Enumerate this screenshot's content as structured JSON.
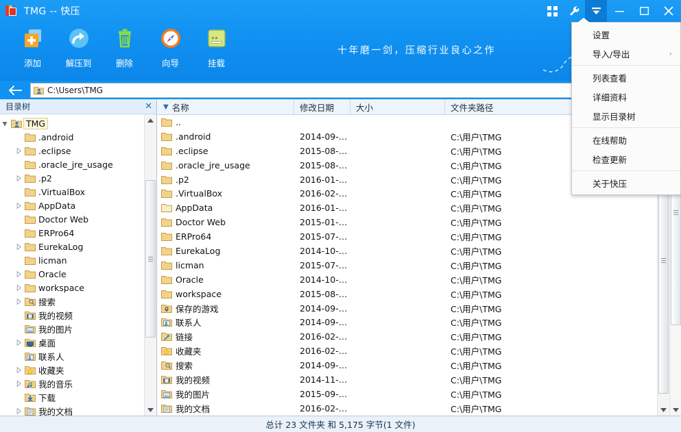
{
  "window": {
    "title": "TMG -- 快压",
    "app_icon": "archive-icon"
  },
  "titlebar_buttons": [
    {
      "name": "apps-grid-icon",
      "label": "应用"
    },
    {
      "name": "wrench-icon",
      "label": "工具"
    },
    {
      "name": "menu-caret-icon",
      "label": "菜单"
    },
    {
      "name": "minimize-icon",
      "label": "最小化"
    },
    {
      "name": "maximize-icon",
      "label": "最大化"
    },
    {
      "name": "close-icon",
      "label": "关闭"
    }
  ],
  "toolbar": {
    "items": [
      {
        "label": "添加",
        "icon": "add-files-icon"
      },
      {
        "label": "解压到",
        "icon": "extract-arrow-icon"
      },
      {
        "label": "删除",
        "icon": "trash-icon"
      },
      {
        "label": "向导",
        "icon": "compass-wizard-icon"
      },
      {
        "label": "挂载",
        "icon": "mount-drive-icon"
      }
    ]
  },
  "banner": {
    "slogan": "十年磨一剑，压缩行业良心之作"
  },
  "address_bar": {
    "back_icon": "back-arrow-icon",
    "folder_icon": "user-folder-icon",
    "path": "C:\\Users\\TMG"
  },
  "tree_panel": {
    "title": "目录树",
    "close_icon": "close-icon",
    "nodes": [
      {
        "label": "TMG",
        "depth": 0,
        "expander": "expanded",
        "icon": "user-folder-icon",
        "selected": true
      },
      {
        "label": ".android",
        "depth": 1,
        "expander": "none",
        "icon": "folder-icon",
        "selected": false
      },
      {
        "label": ".eclipse",
        "depth": 1,
        "expander": "collapsed",
        "icon": "folder-icon",
        "selected": false
      },
      {
        "label": ".oracle_jre_usage",
        "depth": 1,
        "expander": "none",
        "icon": "folder-icon",
        "selected": false
      },
      {
        "label": ".p2",
        "depth": 1,
        "expander": "collapsed",
        "icon": "folder-icon",
        "selected": false
      },
      {
        "label": ".VirtualBox",
        "depth": 1,
        "expander": "none",
        "icon": "folder-icon",
        "selected": false
      },
      {
        "label": "AppData",
        "depth": 1,
        "expander": "collapsed",
        "icon": "folder-icon",
        "selected": false
      },
      {
        "label": "Doctor Web",
        "depth": 1,
        "expander": "none",
        "icon": "folder-icon",
        "selected": false
      },
      {
        "label": "ERPro64",
        "depth": 1,
        "expander": "none",
        "icon": "folder-icon",
        "selected": false
      },
      {
        "label": "EurekaLog",
        "depth": 1,
        "expander": "collapsed",
        "icon": "folder-icon",
        "selected": false
      },
      {
        "label": "licman",
        "depth": 1,
        "expander": "none",
        "icon": "folder-icon",
        "selected": false
      },
      {
        "label": "Oracle",
        "depth": 1,
        "expander": "collapsed",
        "icon": "folder-icon",
        "selected": false
      },
      {
        "label": "workspace",
        "depth": 1,
        "expander": "collapsed",
        "icon": "folder-icon",
        "selected": false
      },
      {
        "label": "搜索",
        "depth": 1,
        "expander": "collapsed",
        "icon": "search-folder-icon",
        "selected": false
      },
      {
        "label": "我的视频",
        "depth": 1,
        "expander": "none",
        "icon": "videos-folder-icon",
        "selected": false
      },
      {
        "label": "我的图片",
        "depth": 1,
        "expander": "none",
        "icon": "pictures-folder-icon",
        "selected": false
      },
      {
        "label": "桌面",
        "depth": 1,
        "expander": "collapsed",
        "icon": "desktop-folder-icon",
        "selected": false
      },
      {
        "label": "联系人",
        "depth": 1,
        "expander": "none",
        "icon": "contacts-folder-icon",
        "selected": false
      },
      {
        "label": "收藏夹",
        "depth": 1,
        "expander": "collapsed",
        "icon": "favorites-folder-icon",
        "selected": false
      },
      {
        "label": "我的音乐",
        "depth": 1,
        "expander": "collapsed",
        "icon": "music-folder-icon",
        "selected": false
      },
      {
        "label": "下载",
        "depth": 1,
        "expander": "none",
        "icon": "downloads-folder-icon",
        "selected": false
      },
      {
        "label": "我的文档",
        "depth": 1,
        "expander": "collapsed",
        "icon": "documents-folder-icon",
        "selected": false
      }
    ]
  },
  "file_list": {
    "columns": [
      {
        "label": "名称",
        "sorted": true
      },
      {
        "label": "修改日期",
        "sorted": false
      },
      {
        "label": "大小",
        "sorted": false
      },
      {
        "label": "文件夹路径",
        "sorted": false
      }
    ],
    "sort_arrow": "▼",
    "rows": [
      {
        "name": "..",
        "date": "",
        "size": "",
        "path": "",
        "icon": "parent-folder-icon"
      },
      {
        "name": ".android",
        "date": "2014-09-…",
        "size": "",
        "path": "C:\\用户\\TMG",
        "icon": "folder-icon"
      },
      {
        "name": ".eclipse",
        "date": "2015-08-…",
        "size": "",
        "path": "C:\\用户\\TMG",
        "icon": "folder-icon"
      },
      {
        "name": ".oracle_jre_usage",
        "date": "2015-08-…",
        "size": "",
        "path": "C:\\用户\\TMG",
        "icon": "folder-icon"
      },
      {
        "name": ".p2",
        "date": "2016-01-…",
        "size": "",
        "path": "C:\\用户\\TMG",
        "icon": "folder-icon"
      },
      {
        "name": ".VirtualBox",
        "date": "2016-02-…",
        "size": "",
        "path": "C:\\用户\\TMG",
        "icon": "folder-icon"
      },
      {
        "name": "AppData",
        "date": "2016-01-…",
        "size": "",
        "path": "C:\\用户\\TMG",
        "icon": "folder-hidden-icon"
      },
      {
        "name": "Doctor Web",
        "date": "2015-01-…",
        "size": "",
        "path": "C:\\用户\\TMG",
        "icon": "folder-icon"
      },
      {
        "name": "ERPro64",
        "date": "2015-07-…",
        "size": "",
        "path": "C:\\用户\\TMG",
        "icon": "folder-icon"
      },
      {
        "name": "EurekaLog",
        "date": "2014-10-…",
        "size": "",
        "path": "C:\\用户\\TMG",
        "icon": "folder-icon"
      },
      {
        "name": "licman",
        "date": "2015-07-…",
        "size": "",
        "path": "C:\\用户\\TMG",
        "icon": "folder-icon"
      },
      {
        "name": "Oracle",
        "date": "2014-10-…",
        "size": "",
        "path": "C:\\用户\\TMG",
        "icon": "folder-icon"
      },
      {
        "name": "workspace",
        "date": "2015-08-…",
        "size": "",
        "path": "C:\\用户\\TMG",
        "icon": "folder-icon"
      },
      {
        "name": "保存的游戏",
        "date": "2014-09-…",
        "size": "",
        "path": "C:\\用户\\TMG",
        "icon": "saved-games-folder-icon"
      },
      {
        "name": "联系人",
        "date": "2014-09-…",
        "size": "",
        "path": "C:\\用户\\TMG",
        "icon": "contacts-folder-icon"
      },
      {
        "name": "链接",
        "date": "2016-02-…",
        "size": "",
        "path": "C:\\用户\\TMG",
        "icon": "links-folder-icon"
      },
      {
        "name": "收藏夹",
        "date": "2016-02-…",
        "size": "",
        "path": "C:\\用户\\TMG",
        "icon": "favorites-folder-icon"
      },
      {
        "name": "搜索",
        "date": "2014-09-…",
        "size": "",
        "path": "C:\\用户\\TMG",
        "icon": "search-folder-icon"
      },
      {
        "name": "我的视频",
        "date": "2014-11-…",
        "size": "",
        "path": "C:\\用户\\TMG",
        "icon": "videos-folder-icon"
      },
      {
        "name": "我的图片",
        "date": "2015-09-…",
        "size": "",
        "path": "C:\\用户\\TMG",
        "icon": "pictures-folder-icon"
      },
      {
        "name": "我的文档",
        "date": "2016-02-…",
        "size": "",
        "path": "C:\\用户\\TMG",
        "icon": "documents-folder-icon"
      }
    ]
  },
  "status_bar": {
    "text": "总计 23 文件夹 和  5,175 字节(1 文件)"
  },
  "dropdown_menu": {
    "items": [
      {
        "label": "设置",
        "submenu": false,
        "sep_after": false
      },
      {
        "label": "导入/导出",
        "submenu": true,
        "sep_after": true
      },
      {
        "label": "列表查看",
        "submenu": false,
        "sep_after": false
      },
      {
        "label": "详细资料",
        "submenu": false,
        "sep_after": false
      },
      {
        "label": "显示目录树",
        "submenu": false,
        "sep_after": true
      },
      {
        "label": "在线帮助",
        "submenu": false,
        "sep_after": false
      },
      {
        "label": "检查更新",
        "submenu": false,
        "sep_after": true
      },
      {
        "label": "关于快压",
        "submenu": false,
        "sep_after": false
      }
    ],
    "submenu_arrow": "›"
  },
  "colors": {
    "title_blue": "#1192f2",
    "accent_blue": "#0b7bd4",
    "header_bg": "#eef4fb",
    "status_bg": "#eaf1f9",
    "folder_yellow": "#f6d77a"
  }
}
